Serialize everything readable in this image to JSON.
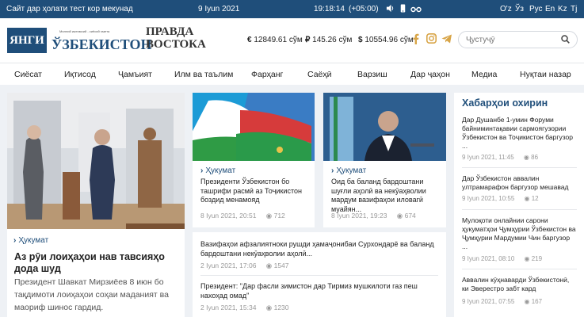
{
  "topbar": {
    "beta_notice": "Сайт дар ҳолати тест кор мекунад",
    "date": "9 Iyun 2021",
    "time": "19:18:14",
    "timezone": "(+05:00)",
    "languages": [
      "O'z",
      "Ўз",
      "Рус",
      "En",
      "Kz",
      "Tj"
    ]
  },
  "header": {
    "logo_box_text": "ЯНГИ",
    "logo_name": "ЎЗБЕКИСТОН",
    "logo_tagline": "Миллий ижтимоий - сиёсий газета",
    "logo2_line1": "ПРАВДА",
    "logo2_line2": "ВОСТОКА",
    "rates": [
      {
        "symbol": "€",
        "value": "12849.61 сўм"
      },
      {
        "symbol": "₽",
        "value": "145.26 сўм"
      },
      {
        "symbol": "$",
        "value": "10554.96 сўм"
      }
    ],
    "search_placeholder": "Ҷустуҷӯ",
    "social_icons": [
      "facebook-icon",
      "instagram-icon",
      "telegram-icon"
    ]
  },
  "nav": [
    "Сиёсат",
    "Иқтисод",
    "Ҷамъият",
    "Илм ва таълим",
    "Фарҳанг",
    "Саёҳӣ",
    "Варзиш",
    "Дар ҷаҳон",
    "Медиа",
    "Нуқтаи назар"
  ],
  "main_story": {
    "category": "Ҳукумат",
    "title": "Аз рӯи лоиҳаҳои нав тавсияҳо дода шуд",
    "excerpt": "Президент Шавкат Мирзиёев 8 июн бо тақдимоти лоиҳаҳои соҳаи маданият ва маориф шинос гардид."
  },
  "cards": [
    {
      "category": "Ҳукумат",
      "title": "Президенти Ўзбекистон бо ташрифи расмӣ аз Тоҷикистон боздид менамояд",
      "date": "8 Iyun 2021, 20:51",
      "views": "712"
    },
    {
      "category": "Ҳукумат",
      "title": "Оид ба баланд бардоштани шуғли аҳолӣ ва некӯаҳволии мардум вазифаҳои иловагӣ муайян...",
      "date": "8 Iyun 2021, 19:23",
      "views": "674"
    }
  ],
  "list_items": [
    {
      "title": "Вазифаҳои афзалиятноки рушди ҳамаҷонибаи Сурхондарё ва баланд бардоштани некӯаҳволии аҳолӣ...",
      "date": "2 Iyun 2021, 17:06",
      "views": "1547"
    },
    {
      "title": "Президент: \"Дар фасли зимистон дар Тирмиз мушкилоти газ пеш нахоҳад омад\"",
      "date": "2 Iyun 2021, 15:34",
      "views": "1230"
    }
  ],
  "sidebar": {
    "title": "Хабарҳои охирин",
    "items": [
      {
        "title": "Дар Душанбе 1-умин Форуми байниминтақавии сармоягузории Ўзбекистон ва Тоҷикистон баргузор ...",
        "date": "9 Iyun 2021, 11:45",
        "views": "86"
      },
      {
        "title": "Дар Ўзбекистон аввалин ултрамарафон баргузор мешавад",
        "date": "9 Iyun 2021, 10:55",
        "views": "12"
      },
      {
        "title": "Мулоқоти онлайнии сарони ҳукуматҳои Ҷумҳурии Ўзбекистон ва Ҷумҳурии Мардумии Чин баргузор ...",
        "date": "9 Iyun 2021, 08:10",
        "views": "219"
      },
      {
        "title": "Аввалин кӯҳнаварди Ўзбекистонӣ, ки Эверестро забт кард",
        "date": "9 Iyun 2021, 07:55",
        "views": "167"
      }
    ]
  },
  "colors": {
    "brand": "#1f4e7a",
    "accent": "#d8a548"
  }
}
